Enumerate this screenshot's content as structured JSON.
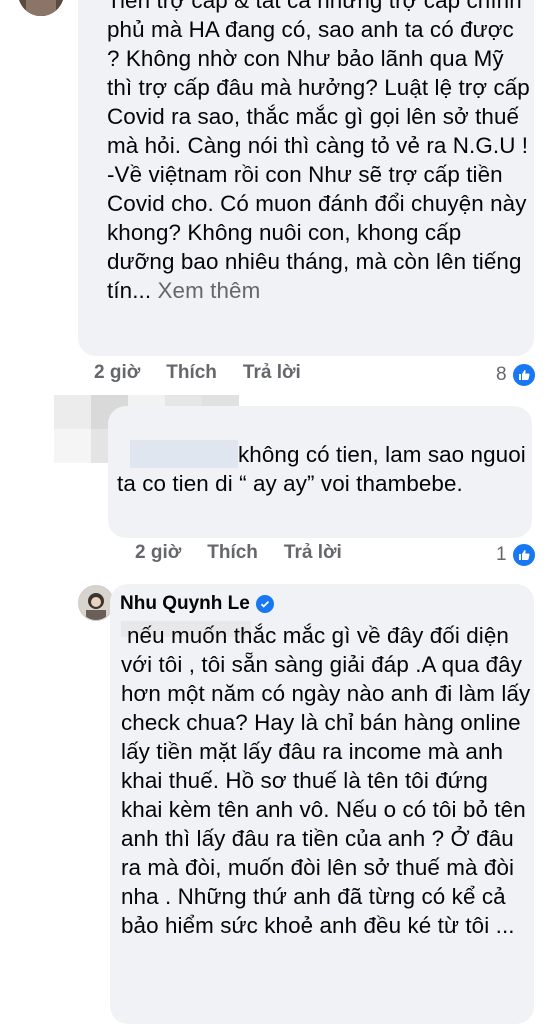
{
  "comments": [
    {
      "text": "Tiền trợ cấp & tất cả những trợ cấp chính phủ mà HA đang có, sao anh ta có được ? Không nhờ con Như bảo lãnh qua Mỹ thì trợ cấp đâu mà hưởng? Luật lệ trợ cấp Covid ra sao, thắc mắc gì gọi lên sở thuế mà hỏi. Càng nói thì càng tỏ vẻ ra N.G.U !\n-Về việtnam rồi con Như sẽ trợ cấp tiền Covid cho. Có muon đánh đổi chuyện này khong? Không nuôi con, khong cấp dưỡng bao nhiêu tháng, mà còn lên tiếng tín...",
      "see_more": "Xem thêm",
      "time": "2 giờ",
      "like": "Thích",
      "reply": "Trả lời",
      "reaction_count": "8"
    },
    {
      "text": "không có tien, lam sao nguoi ta co tien di “ ay ay” voi thambebe.",
      "time": "2 giờ",
      "like": "Thích",
      "reply": "Trả lời",
      "reaction_count": "1"
    },
    {
      "author": "Nhu Quynh Le",
      "text": "nếu muốn thắc mắc gì về đây đối diện với tôi , tôi sẵn sàng giải đáp .A qua đây hơn một năm có ngày nào anh đi làm lấy check chua? Hay là chỉ bán hàng online lấy tiền mặt lấy đâu ra income mà anh khai thuế. Hồ sơ thuế là tên tôi đứng khai kèm tên anh vô. Nếu o có tôi bỏ tên anh thì lấy đâu ra tiền của anh ? Ở đâu ra mà đòi, muốn đòi lên sở thuế mà đòi nha . Những thứ anh đã từng có kể cả bảo hiểm sức khoẻ anh đều ké từ tôi ..."
    }
  ],
  "colors": {
    "bubble": "#f0f2f5",
    "meta": "#65676b",
    "accent": "#1877f2"
  },
  "icons": {
    "like": "like-reaction-icon",
    "verified": "verified-badge-icon"
  }
}
